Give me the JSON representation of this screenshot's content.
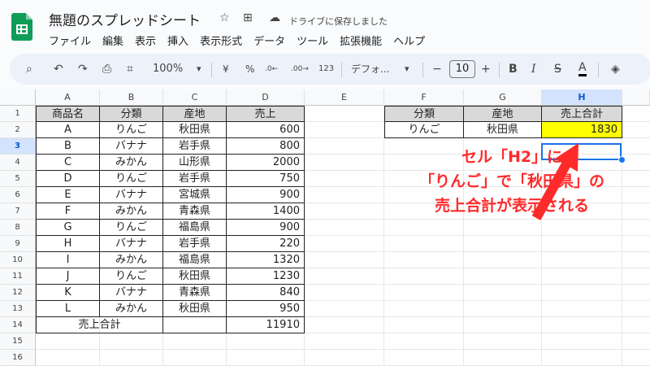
{
  "app": {
    "title": "無題のスプレッドシート",
    "save_status": "ドライブに保存しました",
    "star_icon": "☆",
    "folder_icon": "⊞",
    "cloud_icon": "☁"
  },
  "menu": [
    "ファイル",
    "編集",
    "表示",
    "挿入",
    "表示形式",
    "データ",
    "ツール",
    "拡張機能",
    "ヘルプ"
  ],
  "toolbar": {
    "search": "⌕",
    "undo": "↶",
    "redo": "↷",
    "print": "⎙",
    "paint_format": "⌗",
    "zoom": "100%",
    "zoom_arrow": "▾",
    "currency": "¥",
    "percent": "%",
    "dec_decrease": ".0←",
    "dec_increase": ".00→",
    "format_123": "123",
    "font": "デフォ...",
    "font_arrow": "▾",
    "minus": "−",
    "font_size": "10",
    "plus": "+",
    "bold": "B",
    "italic": "I",
    "strike": "S",
    "text_color": "A",
    "fill": "◈"
  },
  "columns": [
    "A",
    "B",
    "C",
    "D",
    "E",
    "F",
    "G",
    "H"
  ],
  "rows": [
    "1",
    "2",
    "3",
    "4",
    "5",
    "6",
    "7",
    "8",
    "9",
    "10",
    "11",
    "12",
    "13",
    "14",
    "15",
    "16"
  ],
  "table": {
    "headers": [
      "商品名",
      "分類",
      "産地",
      "売上"
    ],
    "rows": [
      [
        "A",
        "りんご",
        "秋田県",
        "600"
      ],
      [
        "B",
        "バナナ",
        "岩手県",
        "800"
      ],
      [
        "C",
        "みかん",
        "山形県",
        "2000"
      ],
      [
        "D",
        "りんご",
        "岩手県",
        "750"
      ],
      [
        "E",
        "バナナ",
        "宮城県",
        "900"
      ],
      [
        "F",
        "みかん",
        "青森県",
        "1400"
      ],
      [
        "G",
        "りんご",
        "福島県",
        "900"
      ],
      [
        "H",
        "バナナ",
        "岩手県",
        "220"
      ],
      [
        "I",
        "みかん",
        "福島県",
        "1320"
      ],
      [
        "J",
        "りんご",
        "秋田県",
        "1230"
      ],
      [
        "K",
        "バナナ",
        "青森県",
        "840"
      ],
      [
        "L",
        "みかん",
        "秋田県",
        "950"
      ]
    ],
    "total_label": "売上合計",
    "total_value": "11910"
  },
  "summary": {
    "headers": [
      "分類",
      "産地",
      "売上合計"
    ],
    "row": [
      "りんご",
      "秋田県",
      "1830"
    ]
  },
  "annotation": {
    "line1": "セル「H2」に",
    "line2": "「りんご」で「秋田県」の",
    "line3": "売上合計が表示される",
    "color": "#ff2a2a"
  },
  "colors": {
    "accent": "#1a73e8",
    "highlight": "#ffff00",
    "header_fill": "#d9d9d9"
  }
}
